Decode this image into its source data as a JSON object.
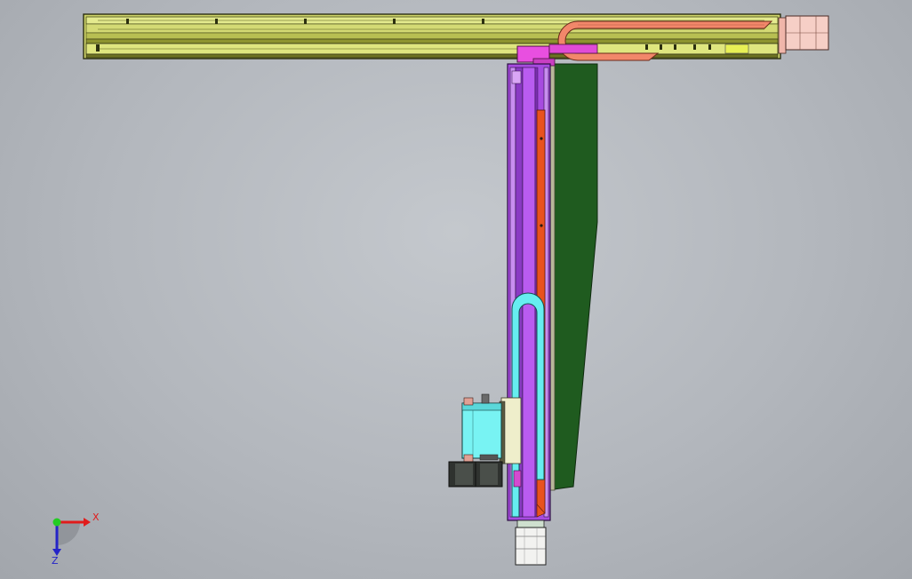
{
  "triad": {
    "x_label": "X",
    "z_label": "Z",
    "x_color": "#e11b1b",
    "y_color": "#22cc22",
    "z_color": "#2424c8"
  },
  "colors": {
    "background": "#b8bcc2",
    "rail_yellow": "#d8e07a",
    "rail_dark": "#3a3f1c",
    "cable_chain_orange": "#f08a6a",
    "cable_chain_cyan": "#66f0f0",
    "vertical_slide_purple": "#b24fe8",
    "red_strip": "#e8501e",
    "green_panel": "#1e5a1e",
    "motor_pink": "#f3c2b8",
    "gearbox_cyan": "#7af5f5",
    "gray_pulley": "#3a3d3a",
    "magenta_block": "#e84fe0"
  }
}
